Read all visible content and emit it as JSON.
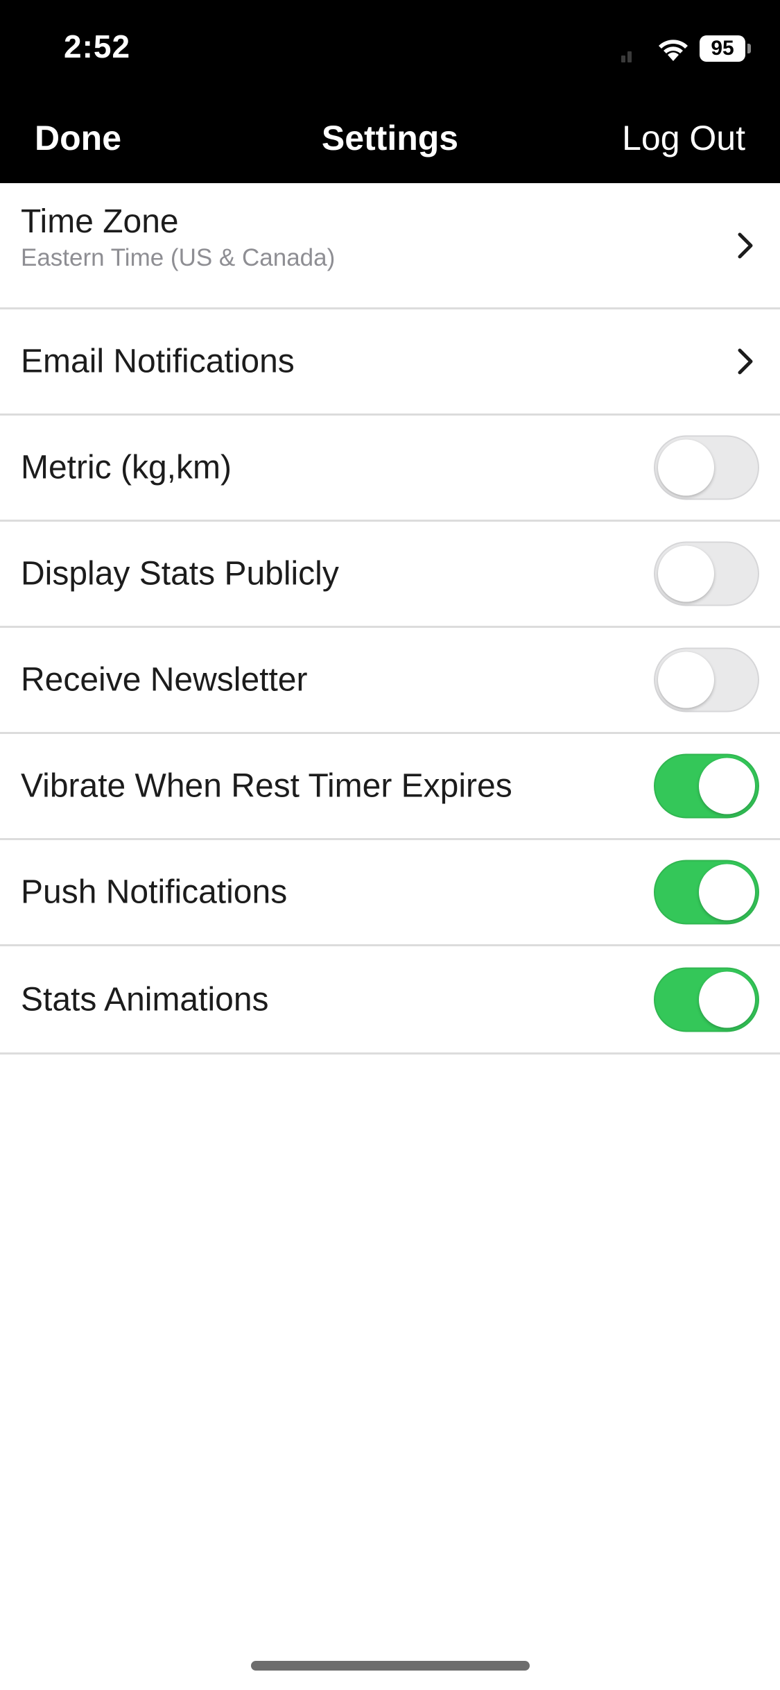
{
  "status_bar": {
    "time": "2:52",
    "battery": "95",
    "icons": [
      "signal-icon",
      "wifi-icon",
      "battery-icon"
    ]
  },
  "nav": {
    "left_label": "Done",
    "title": "Settings",
    "right_label": "Log Out"
  },
  "settings": {
    "time_zone": {
      "label": "Time Zone",
      "value": "Eastern Time (US & Canada)",
      "icon": "chevron-right-icon"
    },
    "email_notifications": {
      "label": "Email Notifications",
      "icon": "chevron-right-icon"
    },
    "metric": {
      "label": "Metric (kg,km)",
      "enabled": false
    },
    "display_stats": {
      "label": "Display Stats Publicly",
      "enabled": false
    },
    "newsletter": {
      "label": "Receive Newsletter",
      "enabled": false
    },
    "vibrate_timer": {
      "label": "Vibrate When Rest Timer Expires",
      "enabled": true
    },
    "push_notifications": {
      "label": "Push Notifications",
      "enabled": true
    },
    "stats_animations": {
      "label": "Stats Animations",
      "enabled": true
    }
  },
  "colors": {
    "header_bg": "#000000",
    "toggle_on": "#34c759",
    "toggle_off": "#e9e9ea",
    "divider": "#dcdcdc",
    "secondary_text": "#8e8e93"
  }
}
